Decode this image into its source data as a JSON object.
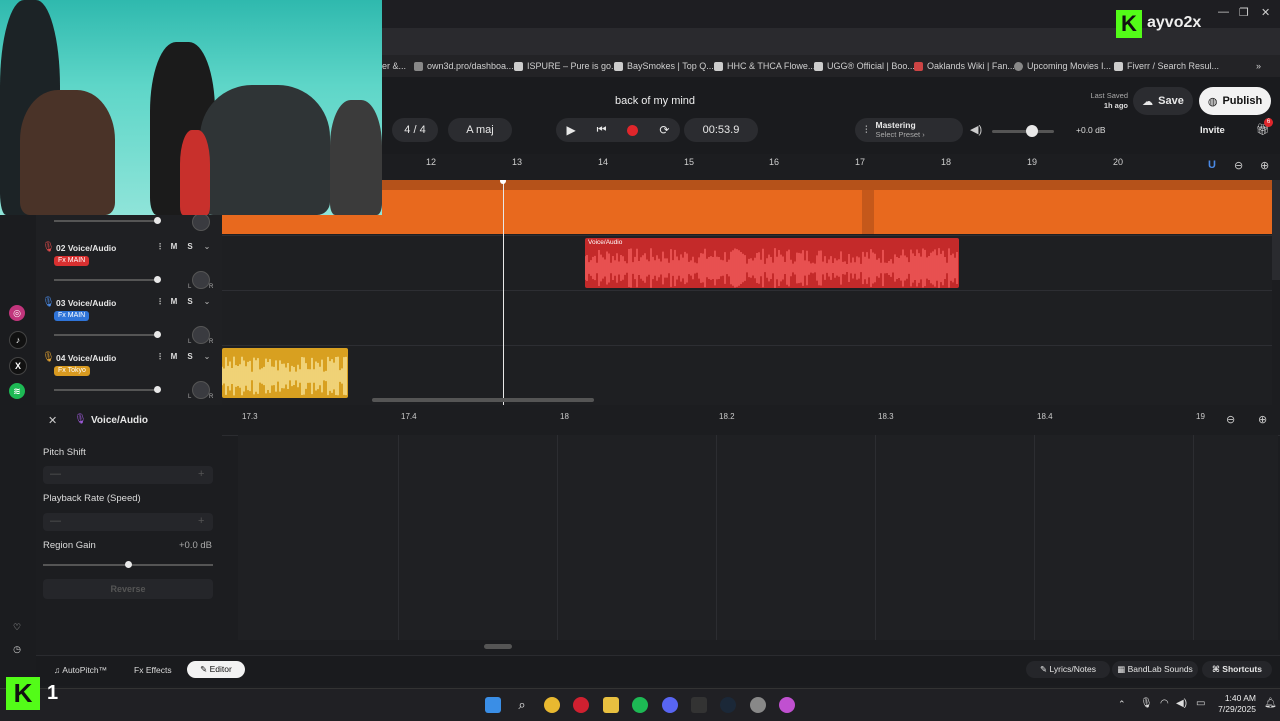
{
  "overlay": {
    "channel": "ayvo2x",
    "badge_number": "1"
  },
  "bookmarks": [
    {
      "label": "er &..."
    },
    {
      "label": "own3d.pro/dashboa..."
    },
    {
      "label": "ISPURE – Pure is go..."
    },
    {
      "label": "BaySmokes | Top Q..."
    },
    {
      "label": "HHC & THCA Flowe..."
    },
    {
      "label": "UGG® Official | Boo..."
    },
    {
      "label": "Oaklands Wiki | Fan..."
    },
    {
      "label": "Upcoming Movies I..."
    },
    {
      "label": "Fiverr / Search Resul..."
    }
  ],
  "header": {
    "song_title": "back of my mind",
    "time_signature": "4 / 4",
    "key": "A maj",
    "time": "00:53.9",
    "mastering_title": "Mastering",
    "mastering_preset": "Select Preset ›",
    "volume_db": "+0.0 dB",
    "last_saved_label": "Last Saved",
    "last_saved_time": "1h ago",
    "save_label": "Save",
    "publish_label": "Publish",
    "invite_label": "Invite",
    "gift_badge": "6"
  },
  "ruler": [
    "12",
    "13",
    "14",
    "15",
    "16",
    "17",
    "18",
    "19",
    "20"
  ],
  "tracks": [
    {
      "number": "02",
      "name": "Voice/Audio",
      "fx": "MAIN",
      "fx_color": "#d83030",
      "mic_color": "#e04a4a"
    },
    {
      "number": "03",
      "name": "Voice/Audio",
      "fx": "MAIN",
      "fx_color": "#2f74d8",
      "mic_color": "#4a8ae6"
    },
    {
      "number": "04",
      "name": "Voice/Audio",
      "fx": "Tokyo",
      "fx_color": "#d89a20",
      "mic_color": "#e0a030"
    }
  ],
  "track_controls": {
    "mute": "M",
    "solo": "S",
    "left": "L",
    "right": "R"
  },
  "regions": {
    "voice_label": "Voice/Audio"
  },
  "editor": {
    "title": "Voice/Audio",
    "ruler": [
      "17.3",
      "17.4",
      "18",
      "18.2",
      "18.3",
      "18.4",
      "19"
    ],
    "pitch_shift_label": "Pitch Shift",
    "playback_rate_label": "Playback Rate (Speed)",
    "region_gain_label": "Region Gain",
    "region_gain_value": "+0.0 dB",
    "reverse_label": "Reverse"
  },
  "bottom": {
    "autopitch": "AutoPitch™",
    "effects": "Effects",
    "editor": "Editor",
    "lyrics": "Lyrics/Notes",
    "sounds": "BandLab Sounds",
    "shortcuts": "Shortcuts"
  },
  "taskbar": {
    "time": "1:40 AM",
    "date": "7/29/2025"
  },
  "colors": {
    "orange_region": "#e8691e",
    "red_region": "#c42a2a",
    "yellow_region": "#d8a020",
    "accent_record": "#e0262b"
  }
}
